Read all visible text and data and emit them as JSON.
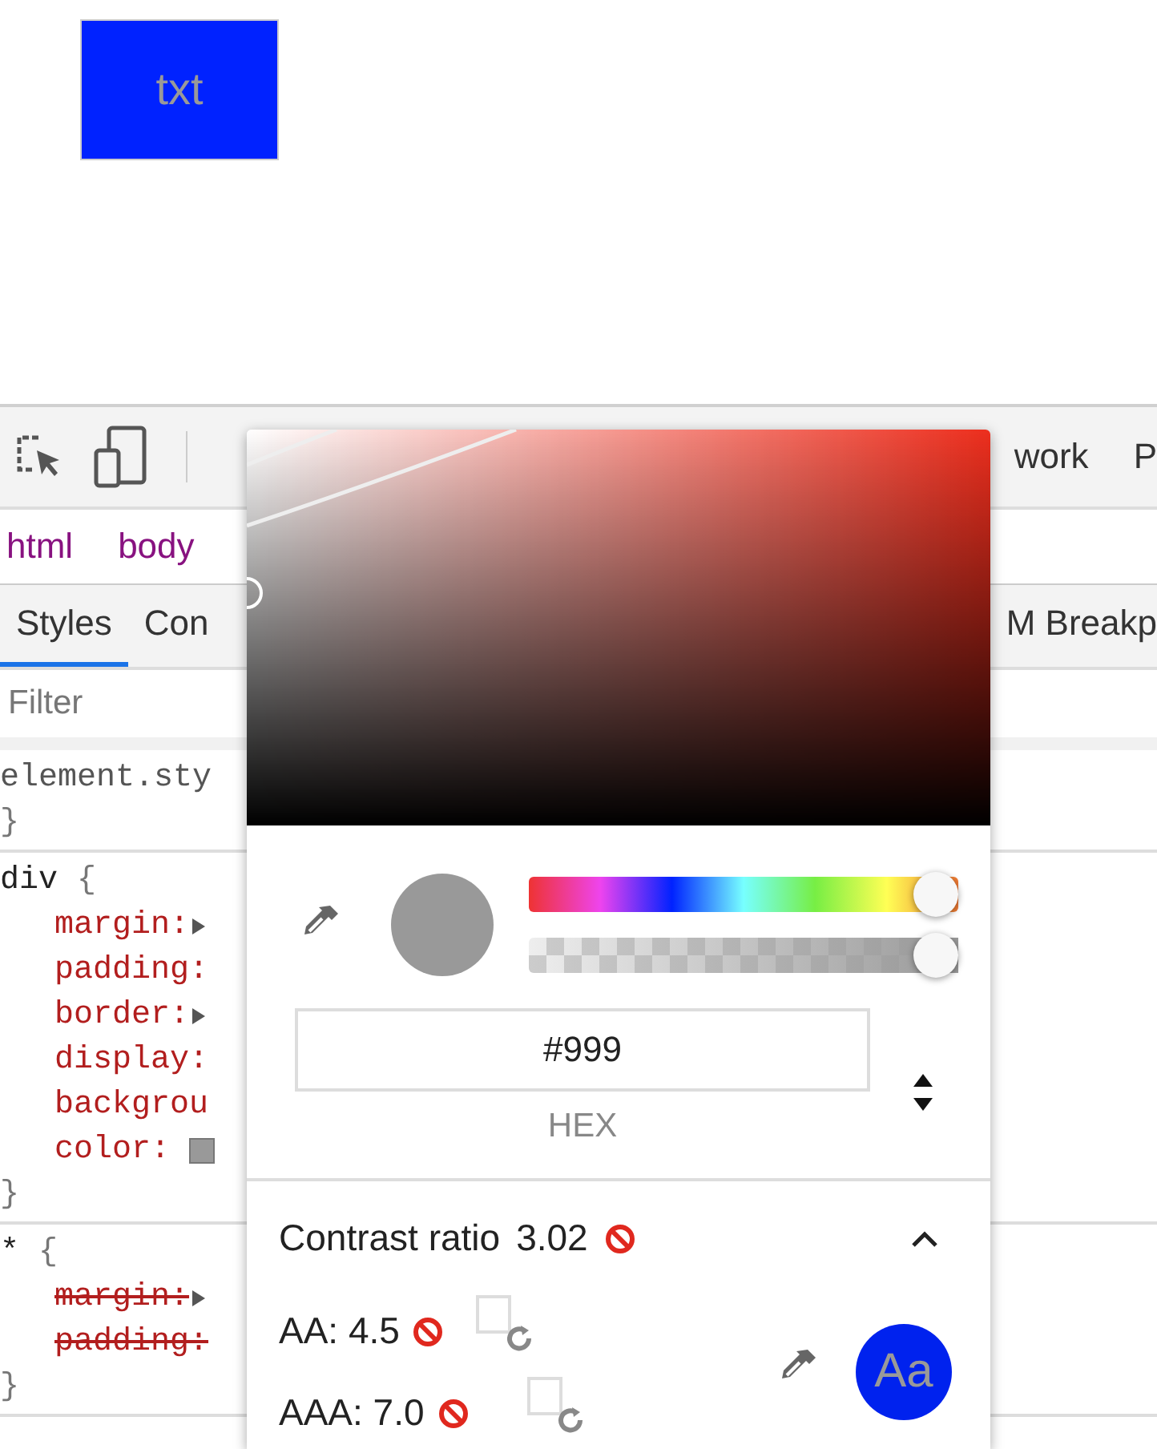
{
  "page": {
    "demo_box": {
      "text": "txt"
    }
  },
  "devtools": {
    "toolbar": {
      "tabs": [
        {
          "label": "work"
        },
        {
          "label": "P"
        }
      ]
    },
    "breadcrumbs": [
      {
        "label": "html"
      },
      {
        "label": "body"
      }
    ],
    "panel_tabs": [
      {
        "label": "Styles",
        "selected": true
      },
      {
        "label": "Con",
        "selected": false
      },
      {
        "label": "M Breakp",
        "selected": false
      }
    ],
    "filter": {
      "placeholder": "Filter"
    },
    "rules": [
      {
        "selector": "element.sty",
        "close": "}"
      },
      {
        "selector": "div",
        "open": "{",
        "close": "}",
        "properties": [
          {
            "name": "margin:",
            "expandable": true,
            "overridden": false,
            "swatch": false
          },
          {
            "name": "padding:",
            "expandable": false,
            "overridden": false,
            "swatch": false
          },
          {
            "name": "border:",
            "expandable": true,
            "overridden": false,
            "swatch": false
          },
          {
            "name": "display:",
            "expandable": false,
            "overridden": false,
            "swatch": false
          },
          {
            "name": "backgrou",
            "expandable": false,
            "overridden": false,
            "swatch": false
          },
          {
            "name": "color:",
            "expandable": false,
            "overridden": false,
            "swatch": true
          }
        ]
      },
      {
        "selector": "*",
        "open": "{",
        "close": "}",
        "properties": [
          {
            "name": "margin:",
            "expandable": true,
            "overridden": true,
            "swatch": false
          },
          {
            "name": "padding:",
            "expandable": false,
            "overridden": true,
            "swatch": false
          }
        ]
      }
    ]
  },
  "color_picker": {
    "hue": {
      "level": 1
    },
    "alpha": {
      "level": 1
    },
    "hex": {
      "value": "#999"
    },
    "format_label": "HEX",
    "contrast": {
      "label": "Contrast ratio",
      "value": "3.02",
      "passes": false,
      "expanded": true,
      "thresholds": [
        {
          "label": "AA: 4.5",
          "passes": false
        },
        {
          "label": "AAA: 7.0",
          "passes": false
        }
      ],
      "preview": "Aa"
    }
  }
}
